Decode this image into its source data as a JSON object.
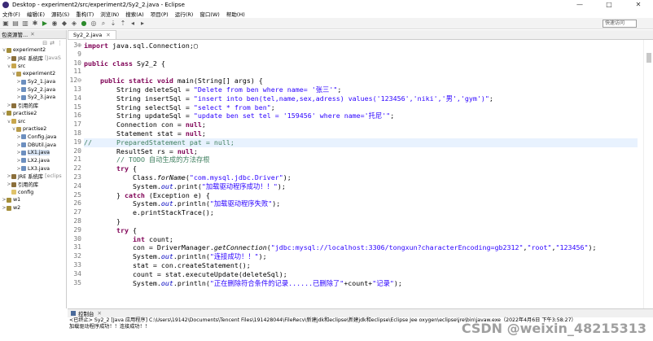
{
  "window": {
    "title": "Desktop - experiment2/src/experiment2/Sy2_2.java - Eclipse",
    "controls": [
      "—",
      "□",
      "✕"
    ]
  },
  "menu": [
    "文件(F)",
    "编辑(E)",
    "源码(S)",
    "重构(T)",
    "浏览(N)",
    "搜索(A)",
    "项目(P)",
    "运行(R)",
    "窗口(W)",
    "帮助(H)"
  ],
  "toolbar": {
    "quick_access": "快速访问"
  },
  "explorer": {
    "title": "包资源管...",
    "close": "✕",
    "tree": [
      {
        "depth": 0,
        "twisty": "v",
        "icon": "proj",
        "label": "experiment2"
      },
      {
        "depth": 1,
        "twisty": ">",
        "icon": "lib",
        "label": "JRE 系统库",
        "dim": "[JavaS"
      },
      {
        "depth": 1,
        "twisty": "v",
        "icon": "src",
        "label": "src"
      },
      {
        "depth": 2,
        "twisty": "v",
        "icon": "pkg",
        "label": "experiment2"
      },
      {
        "depth": 3,
        "twisty": ">",
        "icon": "java",
        "label": "Sy2_1.java"
      },
      {
        "depth": 3,
        "twisty": ">",
        "icon": "java",
        "label": "Sy2_2.java"
      },
      {
        "depth": 3,
        "twisty": ">",
        "icon": "java",
        "label": "Sy2_3.java"
      },
      {
        "depth": 1,
        "twisty": ">",
        "icon": "lib",
        "label": "引用的库"
      },
      {
        "depth": 0,
        "twisty": "v",
        "icon": "proj",
        "label": "practise2"
      },
      {
        "depth": 1,
        "twisty": "v",
        "icon": "src",
        "label": "src"
      },
      {
        "depth": 2,
        "twisty": "v",
        "icon": "pkg",
        "label": "practise2"
      },
      {
        "depth": 3,
        "twisty": ">",
        "icon": "java",
        "label": "Config.java"
      },
      {
        "depth": 3,
        "twisty": ">",
        "icon": "java",
        "label": "DBUtil.java"
      },
      {
        "depth": 3,
        "twisty": ">",
        "icon": "java",
        "label": "LX1.java",
        "selected": true
      },
      {
        "depth": 3,
        "twisty": ">",
        "icon": "java",
        "label": "LX2.java"
      },
      {
        "depth": 3,
        "twisty": ">",
        "icon": "java",
        "label": "LX3.java"
      },
      {
        "depth": 1,
        "twisty": ">",
        "icon": "lib",
        "label": "JRE 系统库",
        "dim": "[eclips"
      },
      {
        "depth": 1,
        "twisty": ">",
        "icon": "lib",
        "label": "引用的库"
      },
      {
        "depth": 1,
        "twisty": " ",
        "icon": "folder",
        "label": "config"
      },
      {
        "depth": 0,
        "twisty": ">",
        "icon": "proj",
        "label": "w1"
      },
      {
        "depth": 0,
        "twisty": ">",
        "icon": "proj",
        "label": "w2"
      }
    ]
  },
  "editor": {
    "tab": "Sy2_2.java",
    "tab_close": "✕",
    "lines": [
      {
        "n": "3⊕",
        "html": "<span class=\"kw\">import</span> java.sql.Connection;▢"
      },
      {
        "n": "9",
        "html": ""
      },
      {
        "n": "10",
        "html": "<span class=\"kw\">public class</span> Sy2_2 {"
      },
      {
        "n": "11",
        "html": ""
      },
      {
        "n": "12⊖",
        "html": "    <span class=\"kw\">public static void</span> main(String[] args) {"
      },
      {
        "n": "13",
        "html": "        String deleteSql = <span class=\"str\">\"Delete from ben where name= '张三'\"</span>;"
      },
      {
        "n": "14",
        "html": "        String insertSql = <span class=\"str\">\"insert into ben(tel,name,sex,adress) values('123456','niki','男','gym')\"</span>;"
      },
      {
        "n": "15",
        "html": "        String selectSql = <span class=\"str\">\"select * from ben\"</span>;"
      },
      {
        "n": "16",
        "html": "        String updateSql = <span class=\"str\">\"update ben set tel = '159456' where name='托尼'\"</span>;"
      },
      {
        "n": "17",
        "html": "        Connection con = <span class=\"kw\">null</span>;"
      },
      {
        "n": "18",
        "html": "        Statement stat = <span class=\"kw\">null</span>;"
      },
      {
        "n": "19",
        "html": "<span class=\"cmt\">//      PreparedStatement pat = null;</span>",
        "hl": true
      },
      {
        "n": "20",
        "html": "        ResultSet rs = <span class=\"kw\">null</span>;"
      },
      {
        "n": "21",
        "html": "        <span class=\"cmt\">// TODO 自动生成的方法存根</span>"
      },
      {
        "n": "22",
        "html": "        <span class=\"kw\">try</span> {"
      },
      {
        "n": "23",
        "html": "            Class.<span class=\"mth\">forName</span>(<span class=\"str\">\"com.mysql.jdbc.Driver\"</span>);"
      },
      {
        "n": "24",
        "html": "            System.<span class=\"fld\">out</span>.print(<span class=\"str\">\"加载驱动程序成功！！\"</span>);"
      },
      {
        "n": "25",
        "html": "        } <span class=\"kw\">catch</span> (Exception e) {"
      },
      {
        "n": "26",
        "html": "            System.<span class=\"fld\">out</span>.println(<span class=\"str\">\"加载驱动程序失败\"</span>);"
      },
      {
        "n": "27",
        "html": "            e.printStackTrace();"
      },
      {
        "n": "28",
        "html": "        }"
      },
      {
        "n": "29",
        "html": "        <span class=\"kw\">try</span> {"
      },
      {
        "n": "30",
        "html": "            <span class=\"kw\">int</span> count;"
      },
      {
        "n": "31",
        "html": "            con = DriverManager.<span class=\"mth\">getConnection</span>(<span class=\"str\">\"jdbc:mysql://localhost:3306/tongxun?characterEncoding=gb2312\"</span>,<span class=\"str\">\"root\"</span>,<span class=\"str\">\"123456\"</span>);"
      },
      {
        "n": "32",
        "html": "            System.<span class=\"fld\">out</span>.println(<span class=\"str\">\"连接成功！！\"</span>);"
      },
      {
        "n": "33",
        "html": "            stat = con.createStatement();"
      },
      {
        "n": "34",
        "html": "            count = stat.executeUpdate(deleteSql);"
      },
      {
        "n": "35",
        "html": "            System.<span class=\"fld\">out</span>.println(<span class=\"str\">\"正在删除符合条件的记录......已删除了\"</span>+count+<span class=\"str\">\"记录\"</span>);"
      }
    ]
  },
  "console": {
    "title": "控制台",
    "close": "✕",
    "lines": [
      "<已终止> Sy2_2 [Java 应用程序] C:\\Users\\19142\\Documents\\Tencent Files\\191428044\\FileRecv\\新建jdk和eclipse\\新建jdk和eclipse\\Eclipse Jee oxygen\\eclipse\\jre\\bin\\javaw.exe（2022年4月6日 下午3:58:27）",
      "加载驱动程序成功！！连接成功！！"
    ]
  },
  "watermark": "CSDN @weixin_48215313"
}
